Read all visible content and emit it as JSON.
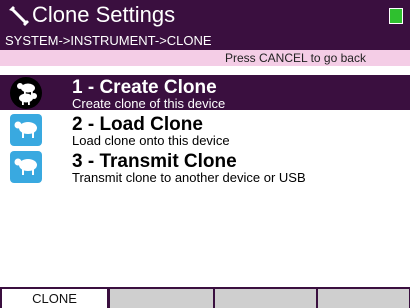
{
  "header": {
    "title": "Clone Settings",
    "breadcrumb": "SYSTEM->INSTRUMENT->CLONE",
    "hint": "Press CANCEL to go back"
  },
  "menu": {
    "items": [
      {
        "title": "1 - Create Clone",
        "description": "Create clone of this device",
        "icon": "sheep-icon",
        "selected": true
      },
      {
        "title": "2 - Load Clone",
        "description": "Load clone onto this device",
        "icon": "sheep-icon",
        "selected": false
      },
      {
        "title": "3 - Transmit Clone",
        "description": "Transmit clone to another device or USB",
        "icon": "sheep-icon",
        "selected": false
      }
    ]
  },
  "tabs": {
    "active": "CLONE",
    "empty_count": 3
  },
  "colors": {
    "header_bg": "#3a0f3f",
    "hint_bg": "#f4cde6",
    "icon_blue": "#39a9e0",
    "status_green": "#2fc02f"
  }
}
